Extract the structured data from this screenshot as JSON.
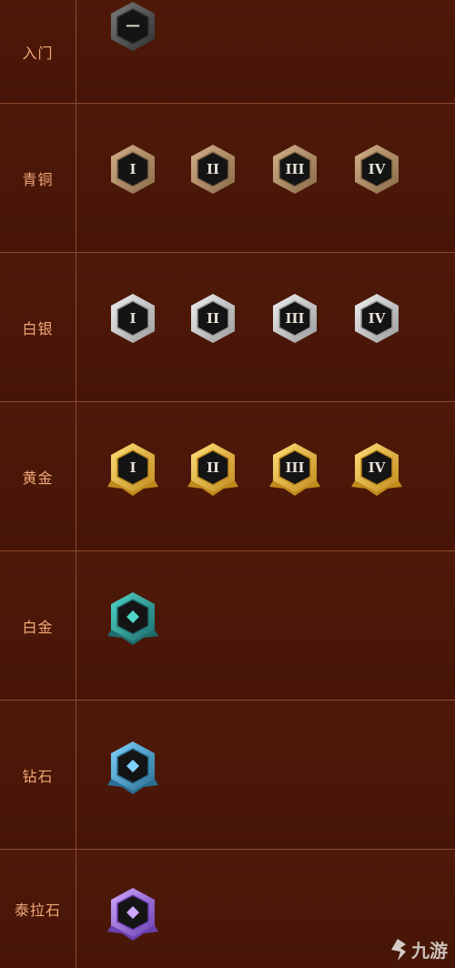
{
  "ranks": [
    {
      "label": "入门",
      "tiers": [
        "一"
      ],
      "theme": "dark",
      "colors": {
        "rim": "#2f2f2f",
        "edge": "#7c7c7c"
      }
    },
    {
      "label": "青铜",
      "tiers": [
        "I",
        "II",
        "III",
        "IV"
      ],
      "theme": "bronze",
      "colors": {
        "rim": "#8a6a48",
        "edge": "#d4b08a"
      }
    },
    {
      "label": "白银",
      "tiers": [
        "I",
        "II",
        "III",
        "IV"
      ],
      "theme": "silver",
      "colors": {
        "rim": "#9a9a9a",
        "edge": "#f0f0f0"
      }
    },
    {
      "label": "黄金",
      "tiers": [
        "I",
        "II",
        "III",
        "IV"
      ],
      "theme": "gold",
      "colors": {
        "rim": "#c18a1c",
        "edge": "#ffe07a"
      }
    },
    {
      "label": "白金",
      "tiers": [
        ""
      ],
      "theme": "platinum",
      "colors": {
        "rim": "#1f6b6b",
        "edge": "#4fd6c9"
      }
    },
    {
      "label": "钻石",
      "tiers": [
        ""
      ],
      "theme": "diamond",
      "colors": {
        "rim": "#2a6f93",
        "edge": "#7fd3ff"
      }
    },
    {
      "label": "泰拉石",
      "tiers": [
        ""
      ],
      "theme": "terra",
      "colors": {
        "rim": "#6a3fb0",
        "edge": "#cfa8ff"
      }
    }
  ],
  "watermark": {
    "text": "九游",
    "icon": "jiuyou-logo-icon"
  }
}
